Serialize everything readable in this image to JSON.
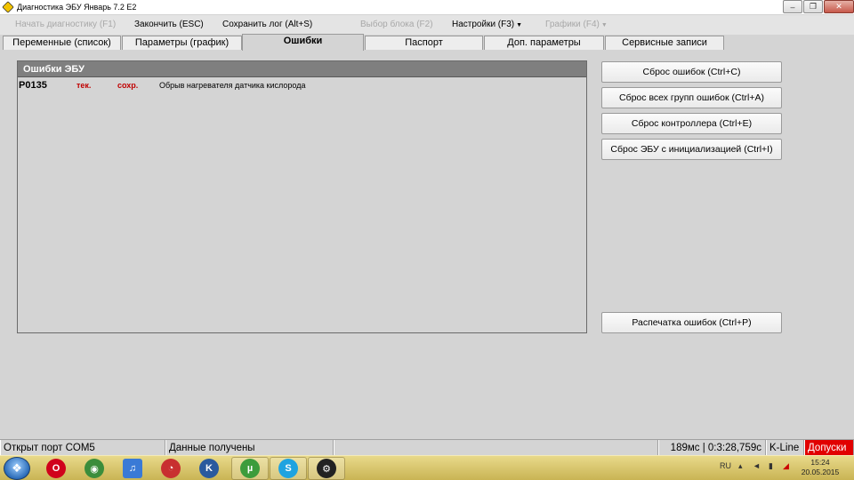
{
  "window": {
    "title": "Диагностика ЭБУ Январь 7.2 E2",
    "minimize_glyph": "–",
    "restore_glyph": "❐",
    "close_glyph": "✕"
  },
  "menu": {
    "start_diag": "Начать диагностику (F1)",
    "finish": "Закончить (ESC)",
    "save_log": "Сохранить лог (Alt+S)",
    "select_block": "Выбор блока (F2)",
    "settings": "Настройки (F3)",
    "graphs": "Графики (F4)",
    "caret": "▼"
  },
  "tabs": [
    {
      "label": "Переменные (список)"
    },
    {
      "label": "Параметры (график)"
    },
    {
      "label": "Ошибки"
    },
    {
      "label": "Паспорт"
    },
    {
      "label": "Доп. параметры"
    },
    {
      "label": "Сервисные записи"
    }
  ],
  "errors_panel": {
    "title": "Ошибки ЭБУ",
    "rows": [
      {
        "code": "P0135",
        "current": "тек.",
        "saved": "сохр.",
        "description": "Обрыв нагревателя датчика кислорода"
      }
    ]
  },
  "buttons": {
    "reset_errors": "Сброс ошибок (Ctrl+C)",
    "reset_all_groups": "Сброс всех групп ошибок (Ctrl+A)",
    "reset_controller": "Сброс контроллера (Ctrl+E)",
    "reset_ecu_init": "Сброс ЭБУ с инициализацией (Ctrl+I)",
    "print_errors": "Распечатка ошибок (Ctrl+P)"
  },
  "status": {
    "port": "Открыт порт COM5",
    "data": "Данные получены",
    "timing": "189мс | 0:3:28,759с",
    "protocol": "K-Line",
    "alert": "Допуски",
    "alert_color": "#e10000"
  },
  "taskbar": {
    "start_glyph": "❖",
    "apps": [
      {
        "icon": "opera-icon",
        "glyph": "O",
        "color": "#d0021b"
      },
      {
        "icon": "chrome-icon",
        "glyph": "◉",
        "color": "#3b8d3b"
      },
      {
        "icon": "music-app-icon",
        "glyph": "♫",
        "color": "#3a7ad6"
      },
      {
        "icon": "speed-gauge-icon",
        "glyph": "◔",
        "color": "#c83030"
      },
      {
        "icon": "k-app-icon",
        "glyph": "K",
        "color": "#2a5a9e"
      },
      {
        "icon": "utorrent-icon",
        "glyph": "µ",
        "color": "#3c9c3c"
      },
      {
        "icon": "skype-icon",
        "glyph": "S",
        "color": "#1fa3e0"
      },
      {
        "icon": "diagnostics-app-icon",
        "glyph": "⚙",
        "color": "#222222"
      }
    ],
    "tray": {
      "language": "RU",
      "time": "15:24",
      "date": "20.05.2015"
    }
  }
}
